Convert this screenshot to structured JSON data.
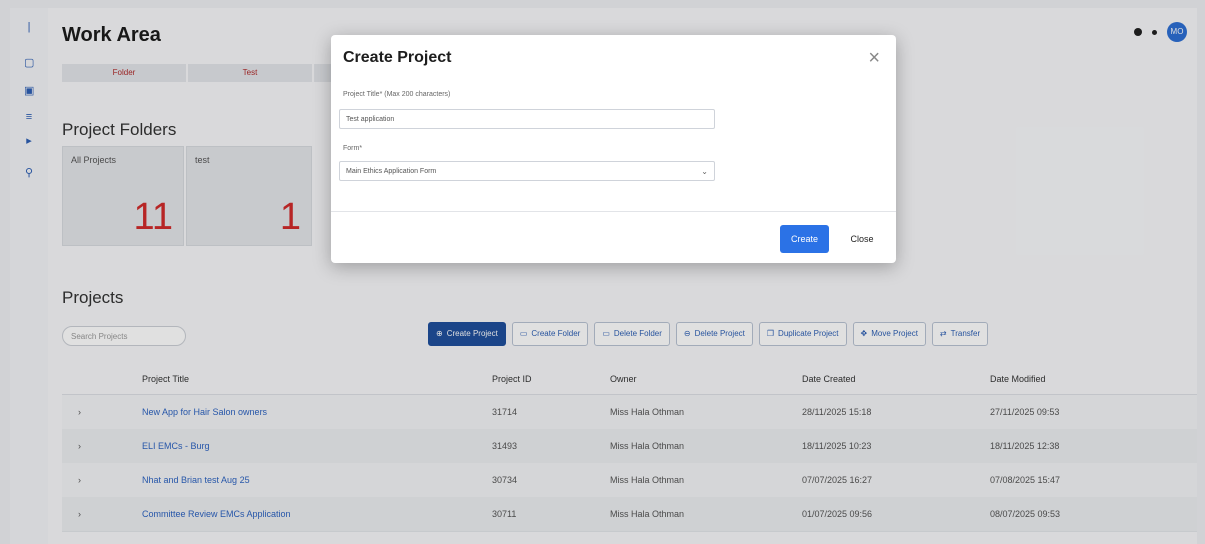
{
  "page": {
    "title": "Work Area"
  },
  "header": {
    "avatar_initials": "MO"
  },
  "mini_tabs": [
    "Folder",
    "Test",
    ""
  ],
  "sections": {
    "folders_title": "Project Folders",
    "projects_title": "Projects"
  },
  "folders": [
    {
      "name": "All Projects",
      "count": "11"
    },
    {
      "name": "test",
      "count": "1"
    }
  ],
  "search": {
    "placeholder": "Search Projects"
  },
  "toolbar": [
    {
      "label": "Create Project",
      "icon": "plus-circle-icon"
    },
    {
      "label": "Create Folder",
      "icon": "folder-icon"
    },
    {
      "label": "Delete Folder",
      "icon": "folder-icon"
    },
    {
      "label": "Delete Project",
      "icon": "minus-circle-icon"
    },
    {
      "label": "Duplicate Project",
      "icon": "copy-icon"
    },
    {
      "label": "Move Project",
      "icon": "move-icon"
    },
    {
      "label": "Transfer",
      "icon": "transfer-icon"
    }
  ],
  "table": {
    "columns": [
      "Project Title",
      "Project ID",
      "Owner",
      "Date Created",
      "Date Modified"
    ],
    "rows": [
      {
        "title": "New App for Hair Salon owners",
        "id": "31714",
        "owner": "Miss Hala Othman",
        "created": "28/11/2025 15:18",
        "modified": "27/11/2025 09:53"
      },
      {
        "title": "ELI EMCs - Burg",
        "id": "31493",
        "owner": "Miss Hala Othman",
        "created": "18/11/2025 10:23",
        "modified": "18/11/2025 12:38"
      },
      {
        "title": "Nhat and Brian test Aug 25",
        "id": "30734",
        "owner": "Miss Hala Othman",
        "created": "07/07/2025 16:27",
        "modified": "07/08/2025 15:47"
      },
      {
        "title": "Committee Review EMCs Application",
        "id": "30711",
        "owner": "Miss Hala Othman",
        "created": "01/07/2025 09:56",
        "modified": "08/07/2025 09:53"
      }
    ]
  },
  "modal": {
    "title": "Create Project",
    "project_title_label": "Project Title* (Max 200 characters)",
    "project_title_value": "Test application",
    "form_label": "Form*",
    "form_value": "Main Ethics Application Form",
    "create_label": "Create",
    "close_label": "Close"
  },
  "colors": {
    "accent": "#2b72e6",
    "toolbar_primary": "#1f4f9c",
    "count_red": "#d12b2b"
  }
}
